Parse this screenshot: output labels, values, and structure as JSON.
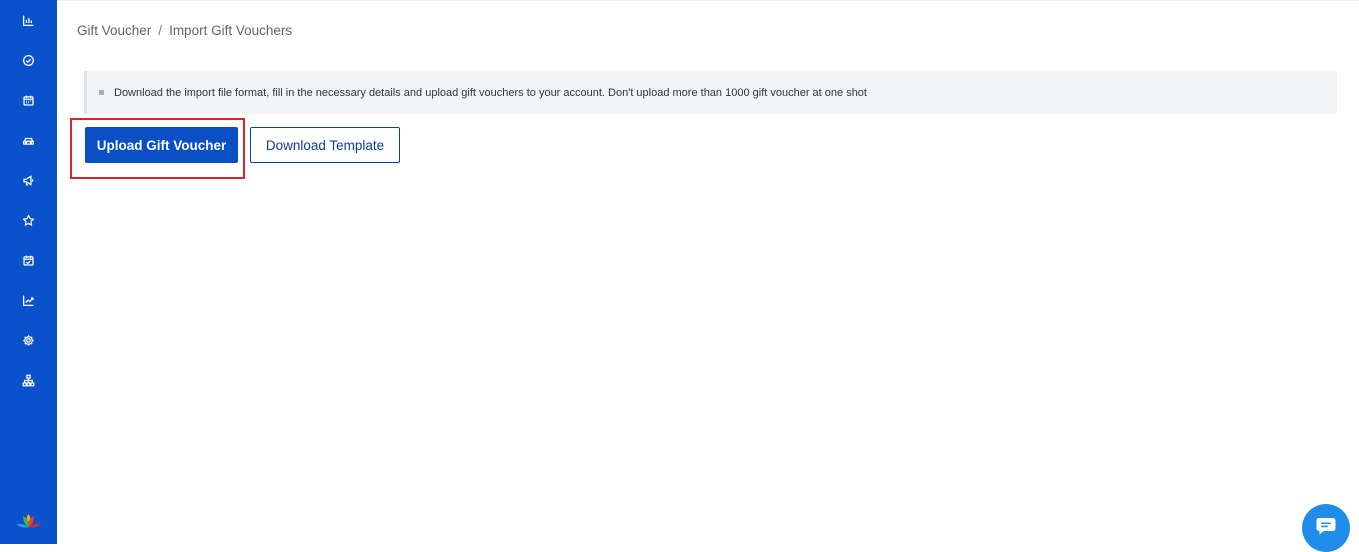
{
  "sidebar": {
    "color": "#0a52cc",
    "items": [
      {
        "icon": "bar-chart-icon"
      },
      {
        "icon": "check-circle-icon"
      },
      {
        "icon": "calendar-icon"
      },
      {
        "icon": "car-icon"
      },
      {
        "icon": "megaphone-icon"
      },
      {
        "icon": "star-icon"
      },
      {
        "icon": "calendar-check-icon"
      },
      {
        "icon": "trending-up-icon"
      },
      {
        "icon": "settings-gear-icon"
      },
      {
        "icon": "sitemap-icon"
      }
    ],
    "logo": "lotus-logo"
  },
  "breadcrumb": {
    "parent": "Gift Voucher",
    "separator": "/",
    "current": "Import Gift Vouchers"
  },
  "info": {
    "text": "Download the import file format, fill in the necessary details and upload gift vouchers to your account. Don't upload more than 1000 gift voucher at one shot"
  },
  "actions": {
    "upload_label": "Upload Gift Voucher",
    "download_label": "Download Template",
    "primary_color": "#0a4fc4",
    "highlight_color": "#d8242e"
  },
  "chat": {
    "icon": "chat-bubble-icon",
    "color": "#1e8ee8"
  }
}
